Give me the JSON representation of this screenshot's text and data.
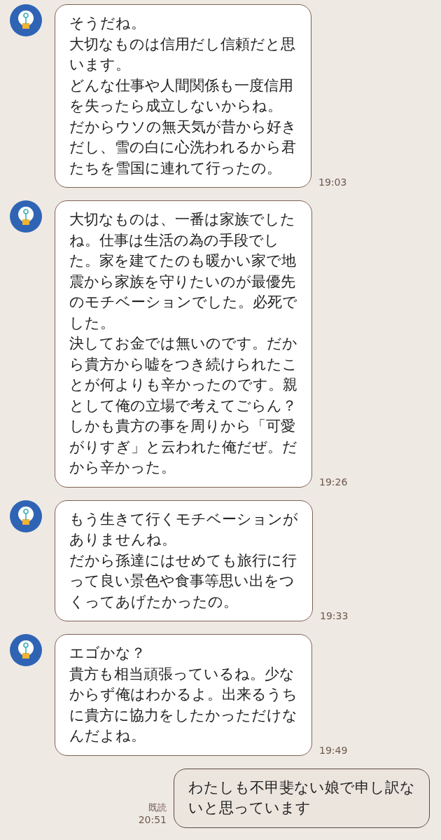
{
  "messages": [
    {
      "kind": "received",
      "lines": [
        "そうだね。",
        "大切なものは信用だし信頼だと思",
        "います。",
        "どんな仕事や人間関係も一度信用",
        "を失ったら成立しないからね。",
        "だからウソの無天気が昔から好き",
        "だし、雪の白に心洗われるから君",
        "たちを雪国に連れて行ったの。"
      ],
      "time": "19:03"
    },
    {
      "kind": "received",
      "lines": [
        "大切なものは、一番は家族でした",
        "ね。仕事は生活の為の手段でし",
        "た。家を建てたのも暖かい家で地",
        "震から家族を守りたいのが最優先",
        "のモチベーションでした。必死で",
        "した。",
        "決してお金では無いのです。だか",
        "ら貴方から嘘をつき続けられたこ",
        "とが何よりも辛かったのです。親",
        "として俺の立場で考えてごらん？",
        "しかも貴方の事を周りから「可愛",
        "がりすぎ」と云われた俺だぜ。だ",
        "から辛かった。"
      ],
      "time": "19:26"
    },
    {
      "kind": "received",
      "lines": [
        "もう生きて行くモチベーションが",
        "ありませんね。",
        "だから孫達にはせめても旅行に行",
        "って良い景色や食事等思い出をつ",
        "くってあげたかったの。"
      ],
      "time": "19:33"
    },
    {
      "kind": "received",
      "lines": [
        "エゴかな？",
        "貴方も相当頑張っているね。少な",
        "からず俺はわかるよ。出来るうち",
        "に貴方に協力をしたかっただけな",
        "んだよね。"
      ],
      "time": "19:49"
    },
    {
      "kind": "sent",
      "lines": [
        "わたしも不甲斐ない娘で申し訳な",
        "いと思っています"
      ],
      "read": "既読",
      "time": "20:51"
    }
  ]
}
